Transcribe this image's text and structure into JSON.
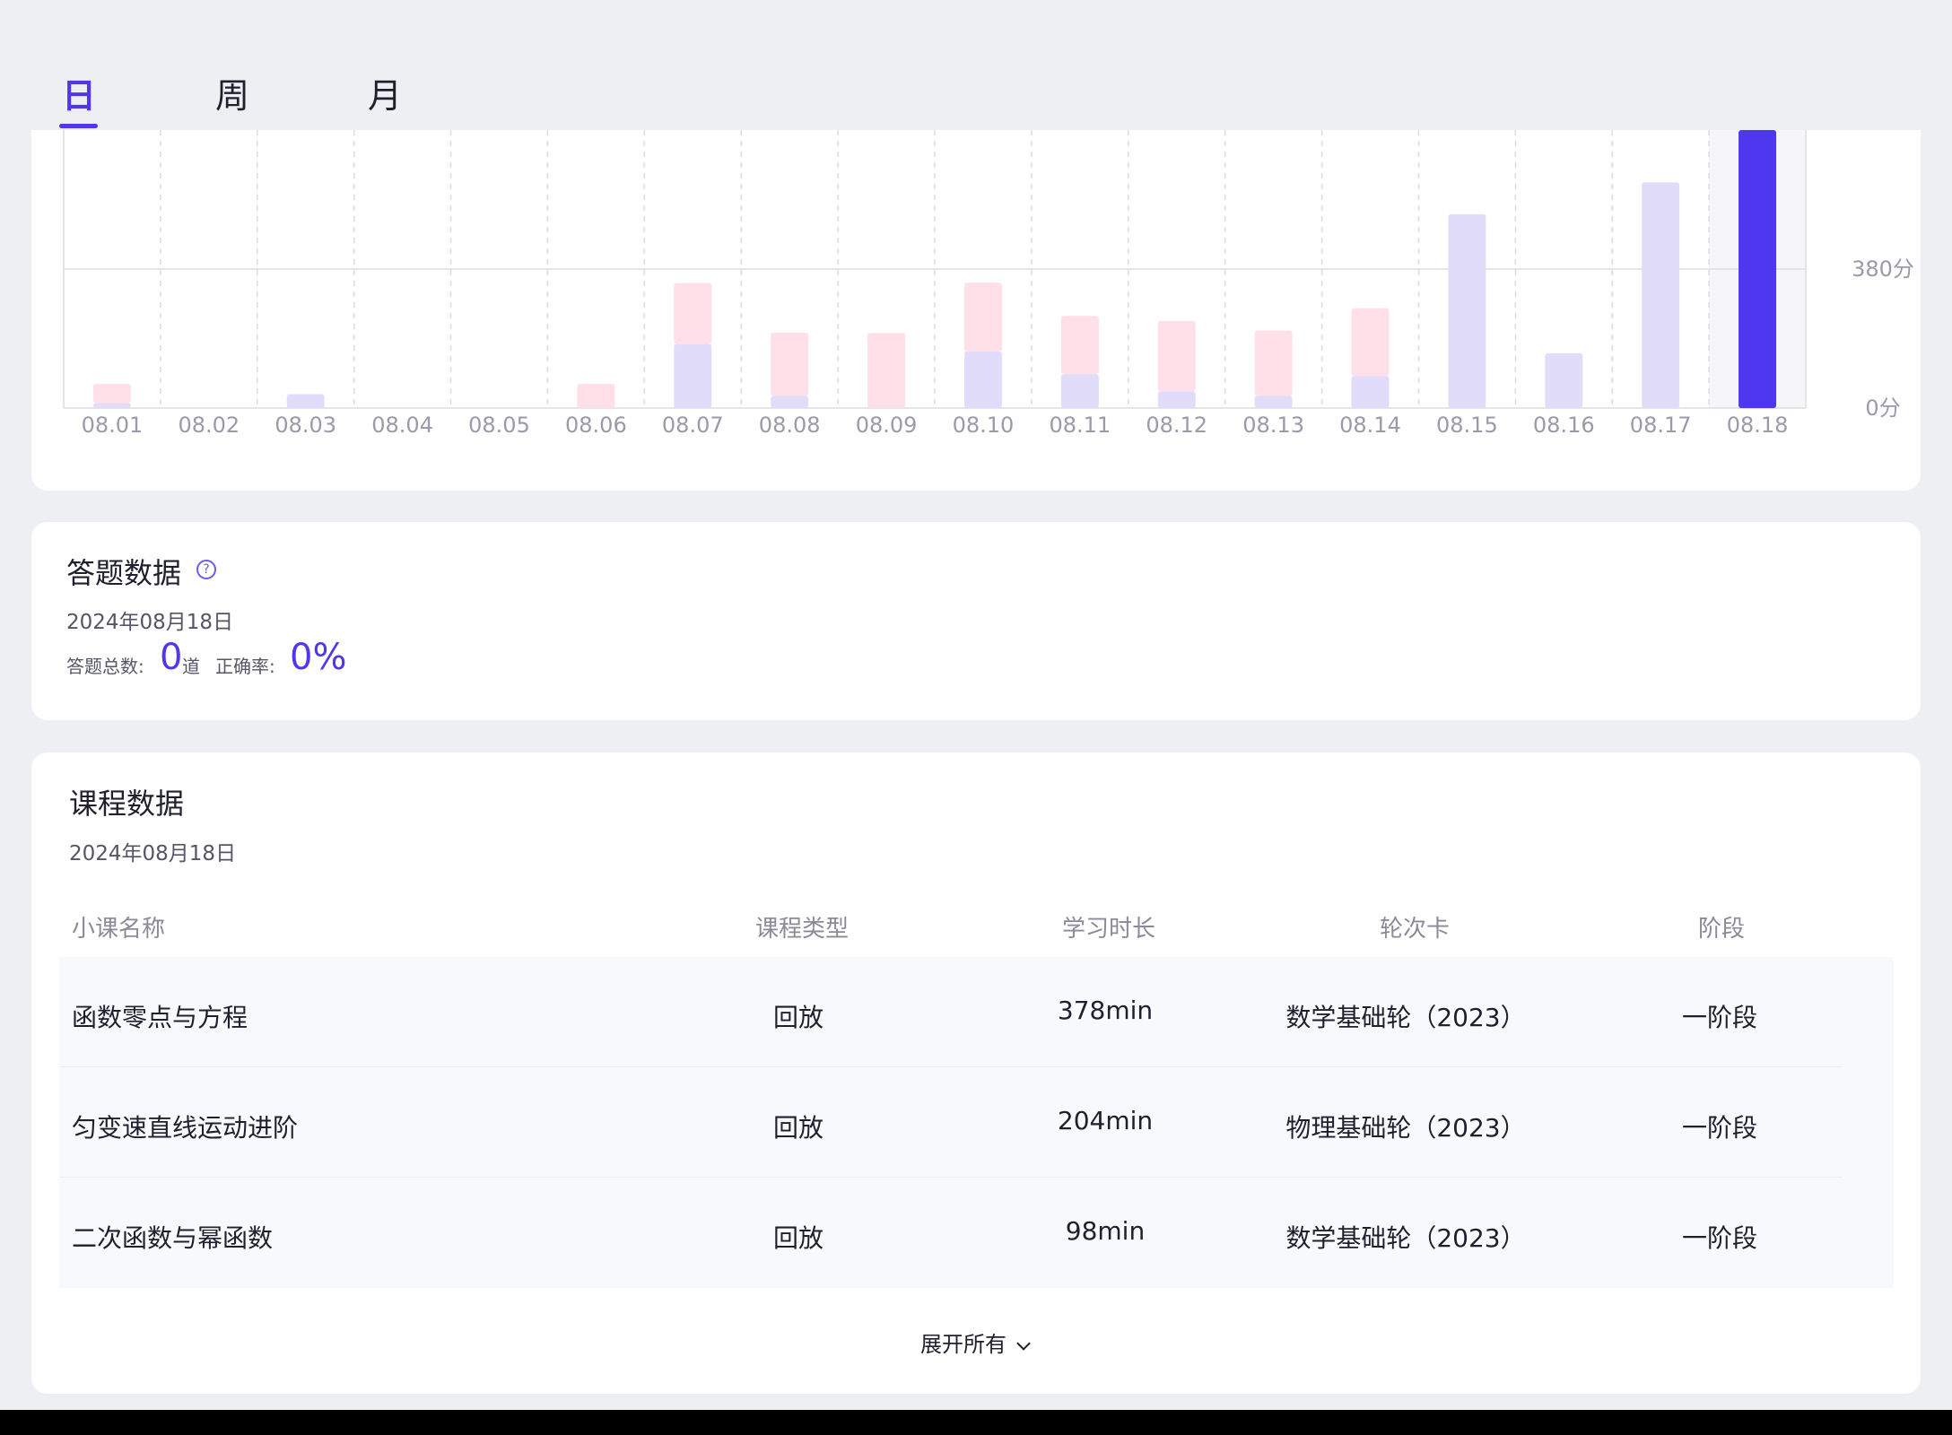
{
  "tabs": {
    "day": "日",
    "week": "周",
    "month": "月",
    "active": "day"
  },
  "chart_data": {
    "type": "bar",
    "stacked": true,
    "categories": [
      "08.01",
      "08.02",
      "08.03",
      "08.04",
      "08.05",
      "08.06",
      "08.07",
      "08.08",
      "08.09",
      "08.10",
      "08.11",
      "08.12",
      "08.13",
      "08.14",
      "08.15",
      "08.16",
      "08.17",
      "08.18"
    ],
    "series": [
      {
        "color": "#e2dcfb",
        "values": [
          14,
          0,
          38,
          0,
          0,
          0,
          175,
          33,
          0,
          155,
          93,
          46,
          34,
          88,
          530,
          150,
          617,
          0
        ]
      },
      {
        "color": "#ffdfe8",
        "values": [
          52,
          0,
          0,
          0,
          0,
          66,
          167,
          173,
          205,
          188,
          159,
          192,
          178,
          185,
          0,
          0,
          0,
          0
        ]
      },
      {
        "color": "#4f37f0",
        "values": [
          0,
          0,
          0,
          0,
          0,
          0,
          0,
          0,
          0,
          0,
          0,
          0,
          0,
          0,
          0,
          0,
          0,
          760
        ]
      }
    ],
    "yticks": [
      {
        "value": 0,
        "label": "0分"
      },
      {
        "value": 380,
        "label": "380分"
      }
    ],
    "ylim": [
      0,
      760
    ],
    "grid": true,
    "selected": "08.18"
  },
  "answers": {
    "title": "答题数据",
    "date": "2024年08月18日",
    "total_label": "答题总数:",
    "total_value": "0",
    "total_unit": "道",
    "accuracy_label": "正确率:",
    "accuracy_value": "0%"
  },
  "courses": {
    "title": "课程数据",
    "date": "2024年08月18日",
    "headers": {
      "name": "小课名称",
      "type": "课程类型",
      "duration": "学习时长",
      "card": "轮次卡",
      "stage": "阶段"
    },
    "rows": [
      {
        "name": "函数零点与方程",
        "type": "回放",
        "duration": "378min",
        "card": "数学基础轮（2023）",
        "stage": "一阶段"
      },
      {
        "name": "匀变速直线运动进阶",
        "type": "回放",
        "duration": "204min",
        "card": "物理基础轮（2023）",
        "stage": "一阶段"
      },
      {
        "name": "二次函数与幂函数",
        "type": "回放",
        "duration": "98min",
        "card": "数学基础轮（2023）",
        "stage": "一阶段"
      }
    ],
    "expand_label": "展开所有"
  }
}
